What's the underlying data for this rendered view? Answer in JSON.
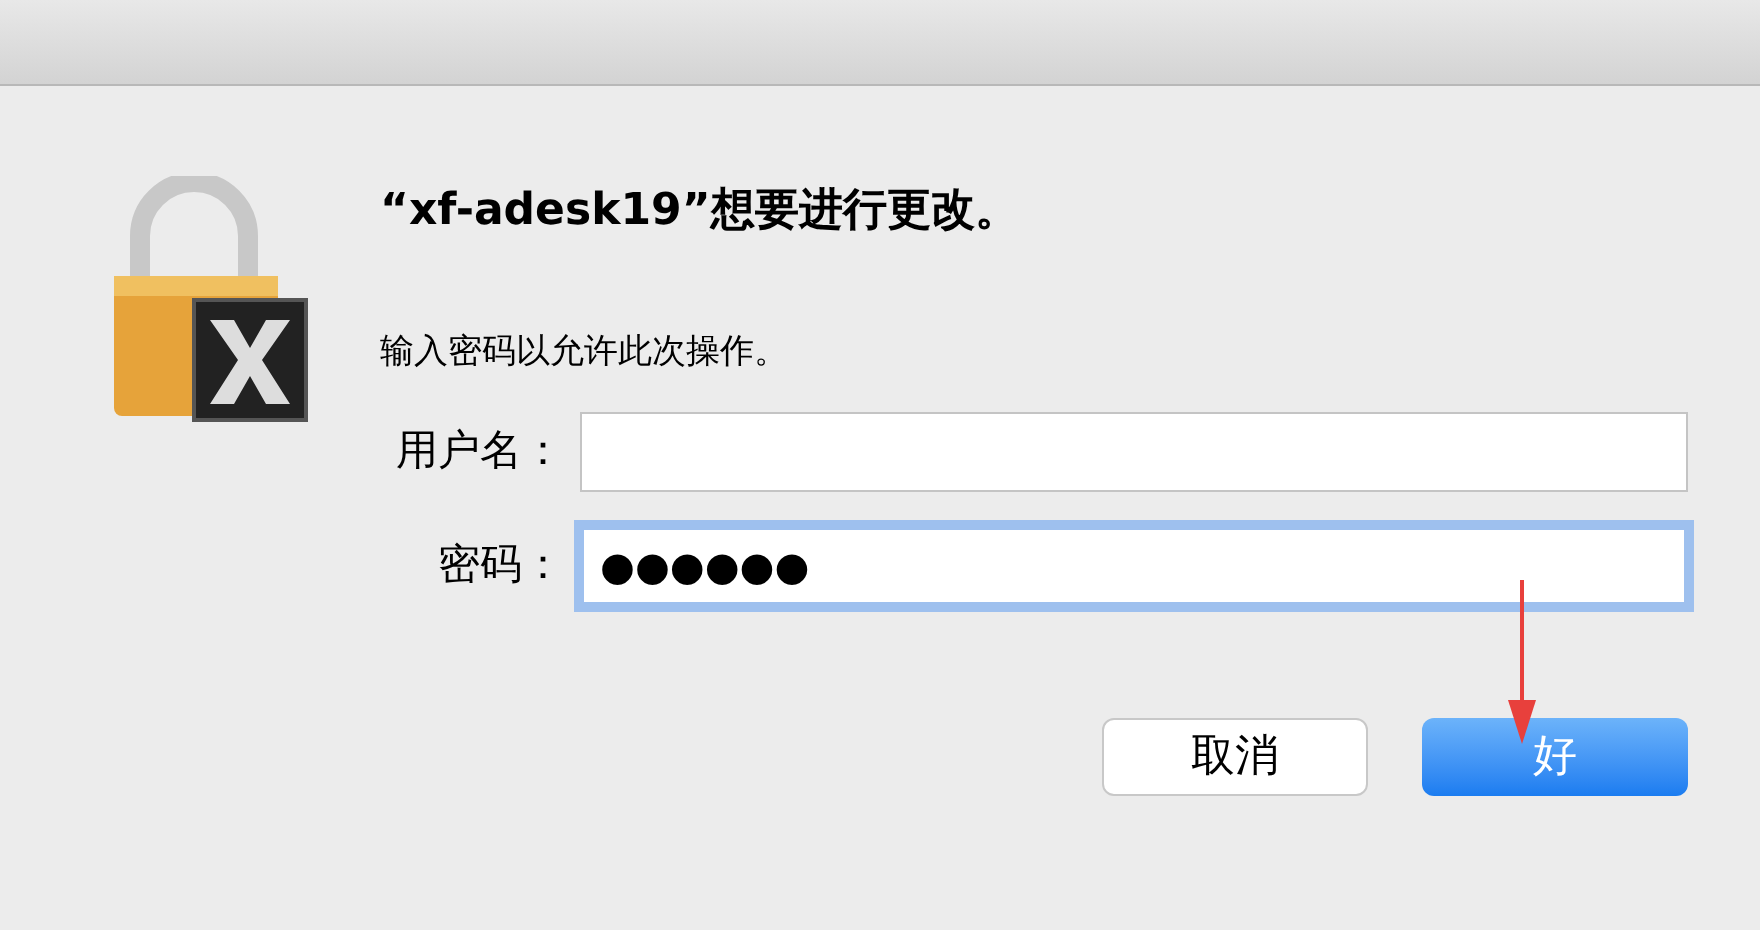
{
  "dialog": {
    "title": "“xf-adesk19”想要进行更改。",
    "message": "输入密码以允许此次操作。"
  },
  "fields": [
    {
      "label": "用户名：",
      "focused": false
    },
    {
      "label": "密码：",
      "value": "●●●●●●",
      "focused": true
    }
  ],
  "buttons": [
    {
      "label": "取消",
      "default": false
    },
    {
      "label": "好",
      "default": true
    }
  ]
}
